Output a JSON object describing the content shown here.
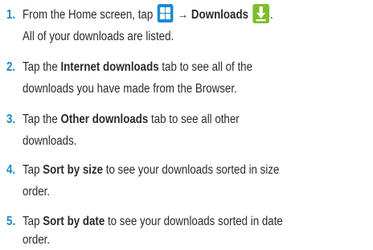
{
  "steps": [
    {
      "number": "1.",
      "line1": {
        "pre": "From the Home screen, tap",
        "arrow": "→",
        "bold": "Downloads",
        "post": "."
      },
      "line2": "All of your downloads are listed."
    },
    {
      "number": "2.",
      "line1": {
        "pre": "Tap the",
        "bold": "Internet downloads",
        "post": "tab to see all of the"
      },
      "line2": "downloads you have made from the Browser."
    },
    {
      "number": "3.",
      "line1": {
        "pre": "Tap the",
        "bold": "Other downloads",
        "post": "tab to see all other"
      },
      "line2": "downloads."
    },
    {
      "number": "4.",
      "line1": {
        "pre": "Tap",
        "bold": "Sort by size",
        "post": "to see your downloads sorted in size"
      },
      "line2": "order."
    },
    {
      "number": "5.",
      "line1": {
        "pre": "Tap",
        "bold": "Sort by date",
        "post": "to see your downloads sorted in date"
      },
      "line2": "order."
    }
  ],
  "icons": {
    "apps": "apps-grid-icon",
    "downloads": "downloads-icon"
  },
  "colors": {
    "step_number": "#1f86c8",
    "apps_icon": "#1e8ad1",
    "downloads_icon": "#7ebd2a",
    "text": "#2b2b2b"
  }
}
